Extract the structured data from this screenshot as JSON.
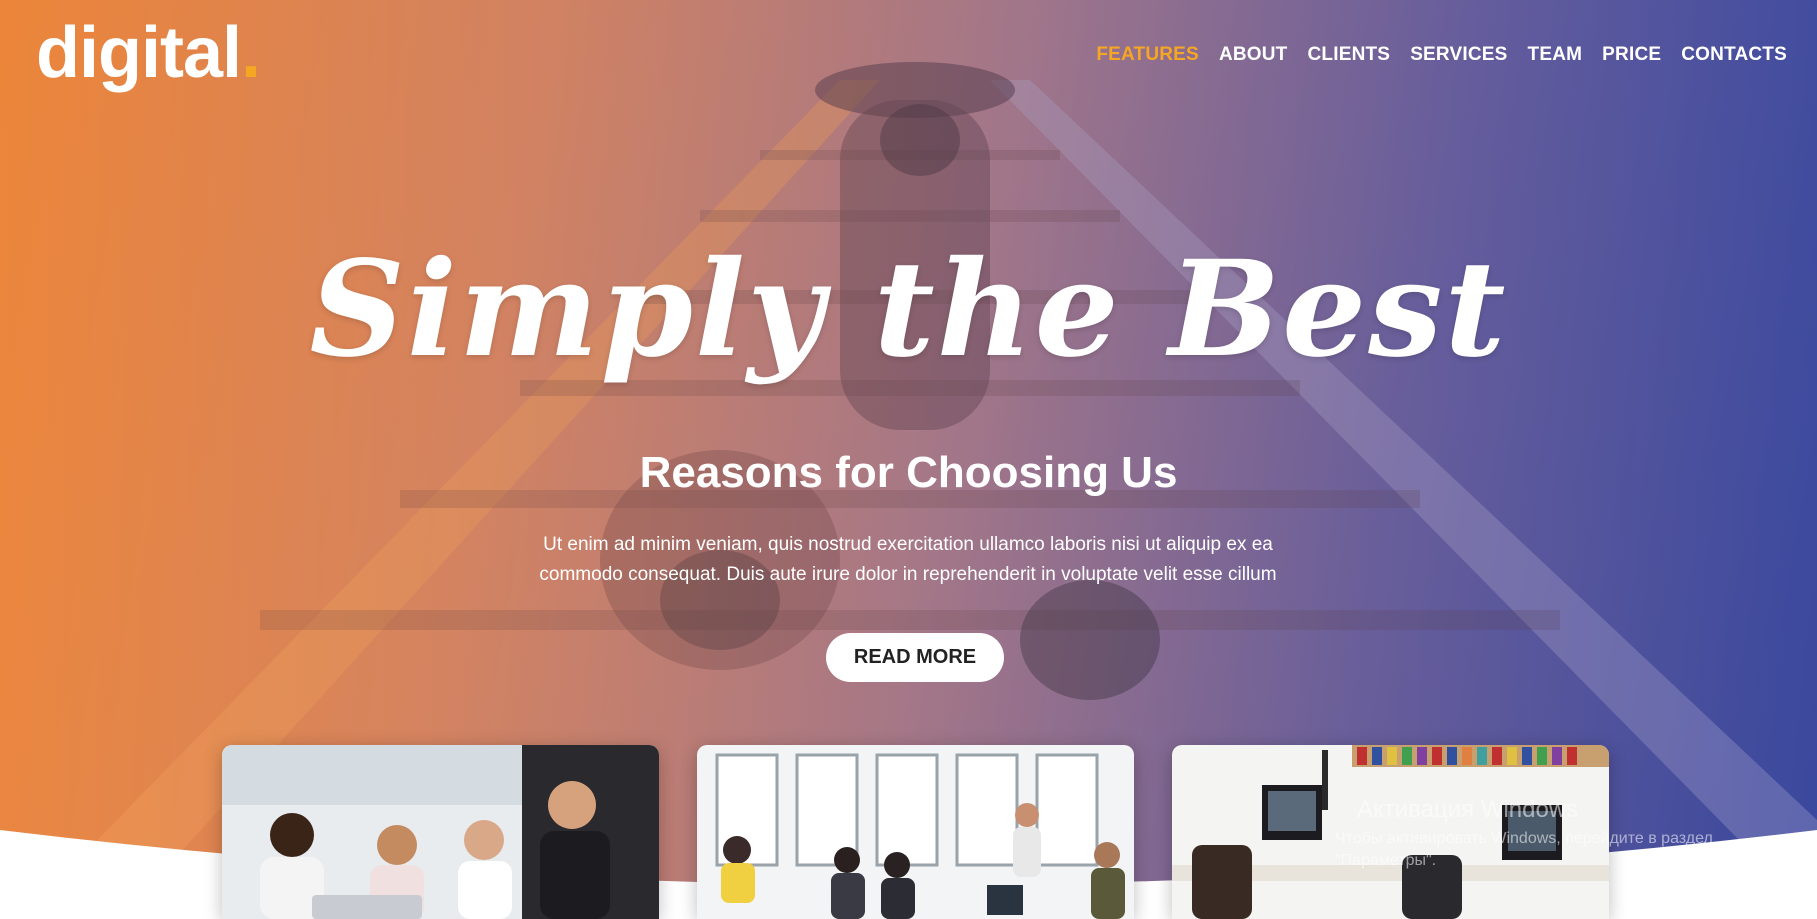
{
  "logo": {
    "text": "digital",
    "dot": "."
  },
  "nav": {
    "items": [
      {
        "label": "FEATURES",
        "active": true
      },
      {
        "label": "ABOUT"
      },
      {
        "label": "CLIENTS"
      },
      {
        "label": "SERVICES"
      },
      {
        "label": "TEAM"
      },
      {
        "label": "PRICE"
      },
      {
        "label": "CONTACTS"
      }
    ]
  },
  "hero": {
    "script_title": "Simply the Best",
    "subtitle": "Reasons for Choosing Us",
    "description_line1": "Ut enim ad minim veniam, quis nostrud exercitation ullamco laboris nisi ut aliquip ex ea",
    "description_line2": "commodo consequat. Duis aute irure dolor in reprehenderit in voluptate velit esse cillum",
    "button_label": "READ MORE"
  },
  "cards": [
    {
      "image": "team-meeting-photo"
    },
    {
      "image": "open-office-photo"
    },
    {
      "image": "workspace-desk-photo"
    }
  ],
  "watermark": {
    "title": "Активация Windows",
    "subtitle": "Чтобы активировать Windows, перейдите в раздел \"Параметры\"."
  },
  "colors": {
    "accent": "#f5a623",
    "gradient_start": "#e87828",
    "gradient_end": "#2d3c96",
    "text": "#ffffff"
  }
}
